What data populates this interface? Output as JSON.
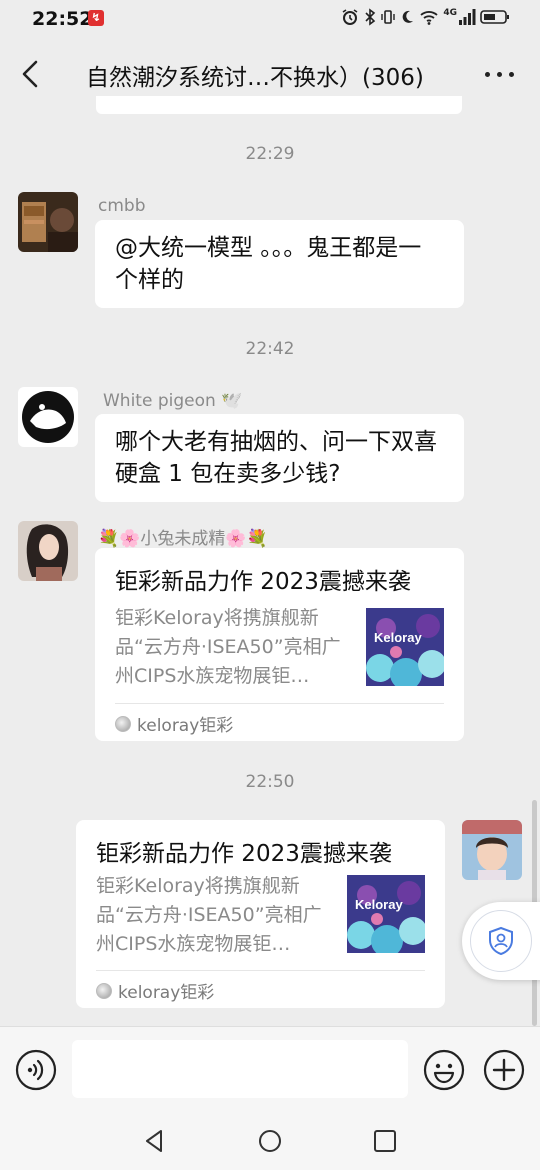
{
  "status": {
    "time": "22:52",
    "network": "4G"
  },
  "header": {
    "title": "自然潮汐系统讨…不换水）(306)"
  },
  "messages": [
    {
      "timestamp": "22:29",
      "sender": "cmbb",
      "text": "@大统一模型 。。。鬼王都是一个样的"
    },
    {
      "timestamp": "22:42",
      "sender": "White pigeon 🕊️",
      "text": "哪个大老有抽烟的、问一下双喜硬盒 1 包在卖多少钱?"
    },
    {
      "sender": "💐🌸小兔未成精🌸💐",
      "card": {
        "title": "钜彩新品力作 2023震撼来袭",
        "desc": "钜彩Keloray将携旗舰新品“云方舟·ISEA50”亮相广州CIPS水族宠物展钜…",
        "thumb_text": "Keloray",
        "source": "keloray钜彩"
      }
    },
    {
      "timestamp": "22:50",
      "sender": "me",
      "card": {
        "title": "钜彩新品力作 2023震撼来袭",
        "desc": "钜彩Keloray将携旗舰新品“云方舟·ISEA50”亮相广州CIPS水族宠物展钜…",
        "thumb_text": "Keloray",
        "source": "keloray钜彩"
      }
    }
  ],
  "icons": {
    "back": "chevron-left-icon",
    "more": "more-dots-icon",
    "voice": "voice-icon",
    "emoji": "emoji-icon",
    "add": "plus-icon",
    "float": "shield-user-icon"
  },
  "colors": {
    "chat_bg": "#ededed",
    "bubble": "#ffffff",
    "timestamp": "#8a8a8a",
    "float_icon": "#4a7be0"
  }
}
